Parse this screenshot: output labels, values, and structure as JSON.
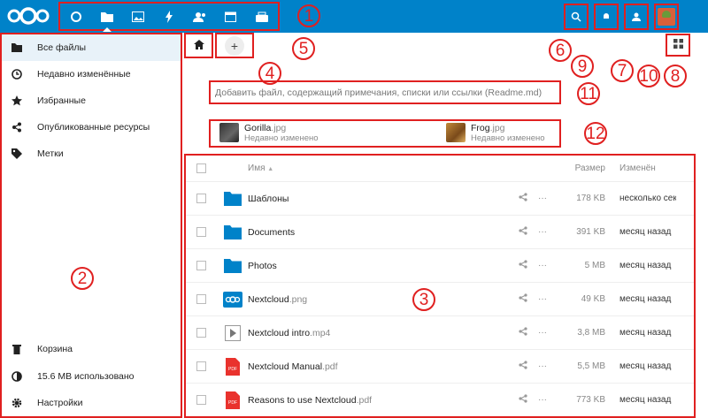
{
  "header": {
    "logo": "nextcloud-logo",
    "apps": [
      "dashboard-icon",
      "files-icon",
      "photos-icon",
      "activity-icon",
      "contacts-icon",
      "calendar-icon",
      "deck-icon"
    ],
    "right_icons": [
      "search-icon",
      "notifications-icon",
      "contacts-menu-icon",
      "user-avatar"
    ]
  },
  "callouts": {
    "c1": "1",
    "c2": "2",
    "c3": "3",
    "c4": "4",
    "c5": "5",
    "c6": "6",
    "c7": "7",
    "c8": "8",
    "c9": "9",
    "c10": "10",
    "c11": "11",
    "c12": "12"
  },
  "sidebar": {
    "items": [
      {
        "label": "Все файлы",
        "icon": "folder-icon"
      },
      {
        "label": "Недавно изменённые",
        "icon": "clock-icon"
      },
      {
        "label": "Избранные",
        "icon": "star-icon"
      },
      {
        "label": "Опубликованные ресурсы",
        "icon": "share-icon"
      },
      {
        "label": "Метки",
        "icon": "tag-icon"
      }
    ],
    "bottom": [
      {
        "label": "Корзина",
        "icon": "trash-icon"
      },
      {
        "label": "15.6 MB использовано",
        "icon": "quota-icon"
      },
      {
        "label": "Настройки",
        "icon": "gear-icon"
      }
    ]
  },
  "breadcrumb": {
    "add_label": "+"
  },
  "readme_placeholder": "Добавить файл, содержащий примечания, списки или ссылки (Readme.md)",
  "recent": [
    {
      "name": "Gorilla",
      "ext": ".jpg",
      "sub": "Недавно изменено"
    },
    {
      "name": "Frog",
      "ext": ".jpg",
      "sub": "Недавно изменено"
    }
  ],
  "table": {
    "col_name": "Имя",
    "sort_indicator": "▲",
    "col_size": "Размер",
    "col_modified": "Изменён",
    "rows": [
      {
        "name": "Шаблоны",
        "ext": "",
        "size": "178 KB",
        "modified": "несколько секунд назад",
        "type": "folder"
      },
      {
        "name": "Documents",
        "ext": "",
        "size": "391 KB",
        "modified": "месяц назад",
        "type": "folder"
      },
      {
        "name": "Photos",
        "ext": "",
        "size": "5 MB",
        "modified": "месяц назад",
        "type": "folder"
      },
      {
        "name": "Nextcloud",
        "ext": ".png",
        "size": "49 KB",
        "modified": "месяц назад",
        "type": "image"
      },
      {
        "name": "Nextcloud intro",
        "ext": ".mp4",
        "size": "3,8 MB",
        "modified": "месяц назад",
        "type": "video"
      },
      {
        "name": "Nextcloud Manual",
        "ext": ".pdf",
        "size": "5,5 MB",
        "modified": "месяц назад",
        "type": "pdf"
      },
      {
        "name": "Reasons to use Nextcloud",
        "ext": ".pdf",
        "size": "773 KB",
        "modified": "месяц назад",
        "type": "pdf"
      }
    ],
    "share_glyph": "<",
    "more_glyph": "···",
    "pdf_label": "PDF"
  },
  "colors": {
    "brand": "#0082c9",
    "callout": "#e02020",
    "folder": "#0082c9",
    "pdf": "#e9322d"
  }
}
